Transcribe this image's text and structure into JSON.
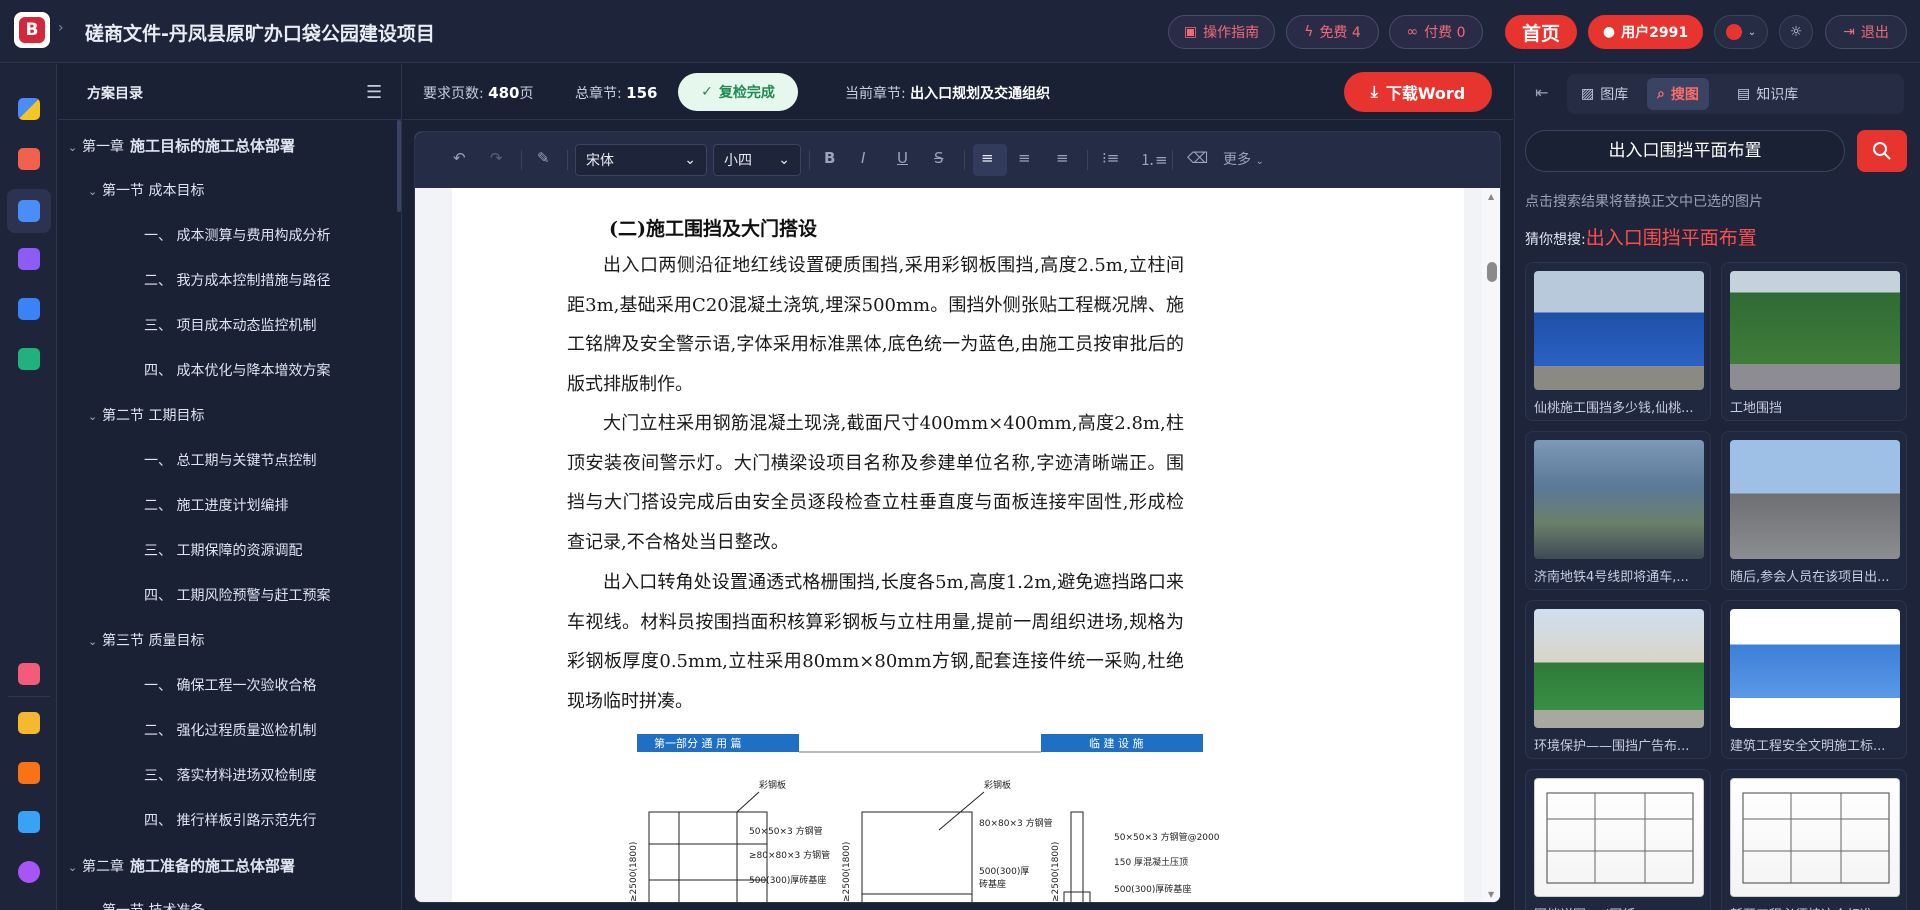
{
  "app": {
    "title": "磋商文件-丹凤县原旷办口袋公园建设项目"
  },
  "topnav": {
    "guide": "操作指南",
    "free": "免费 4",
    "paid": "付费 0",
    "home": "首页",
    "user": "用户2991",
    "logout": "退出"
  },
  "outline": {
    "title": "方案目录",
    "items": [
      {
        "level": 1,
        "prefix": "第一章",
        "label": "施工目标的施工总体部署"
      },
      {
        "level": 2,
        "label": "第一节 成本目标"
      },
      {
        "level": 3,
        "label": "一、 成本测算与费用构成分析"
      },
      {
        "level": 3,
        "label": "二、 我方成本控制措施与路径"
      },
      {
        "level": 3,
        "label": "三、 项目成本动态监控机制"
      },
      {
        "level": 3,
        "label": "四、 成本优化与降本增效方案"
      },
      {
        "level": 2,
        "label": "第二节 工期目标"
      },
      {
        "level": 3,
        "label": "一、 总工期与关键节点控制"
      },
      {
        "level": 3,
        "label": "二、 施工进度计划编排"
      },
      {
        "level": 3,
        "label": "三、 工期保障的资源调配"
      },
      {
        "level": 3,
        "label": "四、 工期风险预警与赶工预案"
      },
      {
        "level": 2,
        "label": "第三节 质量目标"
      },
      {
        "level": 3,
        "label": "一、 确保工程一次验收合格"
      },
      {
        "level": 3,
        "label": "二、 强化过程质量巡检机制"
      },
      {
        "level": 3,
        "label": "三、 落实材料进场双检制度"
      },
      {
        "level": 3,
        "label": "四、 推行样板引路示范先行"
      },
      {
        "level": 1,
        "prefix": "第二章",
        "label": "施工准备的施工总体部署"
      },
      {
        "level": 2,
        "label": "第一节 技术准备"
      }
    ]
  },
  "infobar": {
    "pages_label": "要求页数:",
    "pages_value": "480",
    "pages_unit": "页",
    "chapters_label": "总章节:",
    "chapters_value": "156",
    "recheck": "复检完成",
    "current_label": "当前章节:",
    "current_value": "出入口规划及交通组织",
    "download": "下载Word"
  },
  "toolbar": {
    "font": "宋体",
    "size": "小四",
    "more": "更多"
  },
  "doc": {
    "heading": "(二)施工围挡及大门搭设",
    "paragraphs": [
      "出入口两侧沿征地红线设置硬质围挡,采用彩钢板围挡,高度2.5m,立柱间距3m,基础采用C20混凝土浇筑,埋深500mm。围挡外侧张贴工程概况牌、施工铭牌及安全警示语,字体采用标准黑体,底色统一为蓝色,由施工员按审批后的版式排版制作。",
      "大门立柱采用钢筋混凝土现浇,截面尺寸400mm×400mm,高度2.8m,柱顶安装夜间警示灯。大门横梁设项目名称及参建单位名称,字迹清晰端正。围挡与大门搭设完成后由安全员逐段检查立柱垂直度与面板连接牢固性,形成检查记录,不合格处当日整改。",
      "出入口转角处设置通透式格栅围挡,长度各5m,高度1.2m,避免遮挡路口来车视线。材料员按围挡面积核算彩钢板与立柱用量,提前一周组织进场,规格为彩钢板厚度0.5mm,立柱采用80mm×80mm方钢,配套连接件统一采购,杜绝现场临时拼凑。"
    ],
    "figure": {
      "banner_left": "第一部分 通 用 篇",
      "banner_right": "临 建 设 施",
      "labels": [
        "彩钢板",
        "50×50×3 方钢管",
        "≥80×80×3 方钢管",
        "500(300)厚砖基座",
        "彩钢板",
        "80×80×3 方钢管",
        "500(300)厚",
        "砖基座",
        "50×50×3 方钢管@2000",
        "150 厚混凝土压顶",
        "500(300)厚砖基座",
        "≥2500(1800)",
        "≥2500(1800)",
        "≥2500(1800)"
      ]
    }
  },
  "rightpanel": {
    "tabs": [
      "图库",
      "搜图",
      "知识库"
    ],
    "search_value": "出入口围挡平面布置",
    "hint": "点击搜索结果将替换正文中已选的图片",
    "guess_label": "猜你想搜:",
    "guess_value": "出入口围挡平面布置",
    "results": [
      {
        "caption": "仙桃施工围挡多少钱,仙桃..."
      },
      {
        "caption": "工地围挡"
      },
      {
        "caption": "济南地铁4号线即将通车,..."
      },
      {
        "caption": "随后,参会人员在该项目出..."
      },
      {
        "caption": "环境保护——围挡广告布..."
      },
      {
        "caption": "建筑工程安全文明施工标..."
      },
      {
        "caption": "围挡详图cad图纸"
      },
      {
        "caption": "新开工程必须按这个标准..."
      }
    ]
  },
  "colors": {
    "accent": "#e8342f",
    "bg": "#1b2135",
    "success": "#1f8a52"
  }
}
